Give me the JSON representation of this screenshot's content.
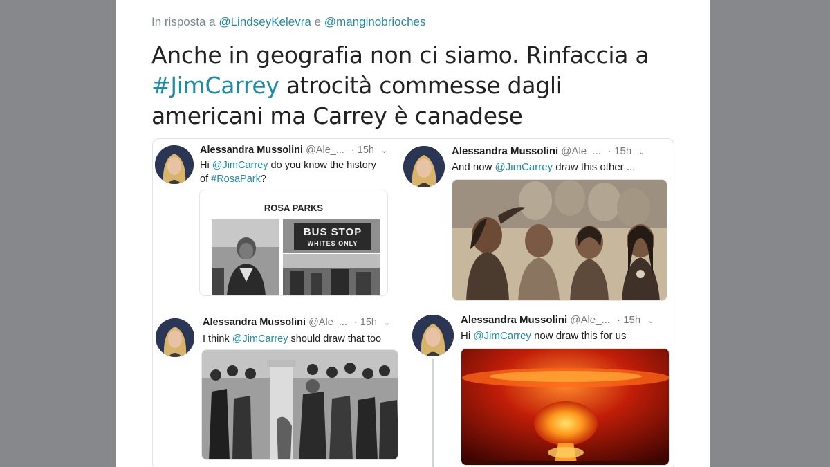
{
  "reply": {
    "prefix": "In risposta a",
    "mention1": "@LindseyKelevra",
    "conj": "e",
    "mention2": "@manginobrioches"
  },
  "tweet": {
    "line1": "Anche in geografia non ci siamo. Rinfaccia a",
    "hashtag": "#JimCarrey",
    "line2_rest": " atrocità commesse dagli",
    "line3": "americani ma Carrey è canadese"
  },
  "embedded": [
    {
      "name": "Alessandra Mussolini",
      "handle": "@Ale_...",
      "time": "· 15h",
      "text_pre": "Hi ",
      "mention": "@JimCarrey",
      "text_post": " do you know the history",
      "text_line2_pre": "of ",
      "text_line2_link": "#RosaPark",
      "text_line2_post": "?",
      "image_title": "ROSA PARKS",
      "sign_line1": "BUS STOP",
      "sign_line2": "WHITES ONLY"
    },
    {
      "name": "Alessandra Mussolini",
      "handle": "@Ale_...",
      "time": "· 15h",
      "text_pre": "And now ",
      "mention": "@JimCarrey",
      "text_post": " draw this other ..."
    },
    {
      "name": "Alessandra Mussolini",
      "handle": "@Ale_...",
      "time": "· 15h",
      "text_pre": "I think ",
      "mention": "@JimCarrey",
      "text_post": " should draw that too"
    },
    {
      "name": "Alessandra Mussolini",
      "handle": "@Ale_...",
      "time": "· 15h",
      "text_pre": "Hi ",
      "mention": "@JimCarrey",
      "text_post": " now draw this for us"
    }
  ],
  "icons": {
    "chevron": "chevron-down-icon"
  },
  "colors": {
    "link": "#1f8ba6",
    "background": "#86888b"
  }
}
